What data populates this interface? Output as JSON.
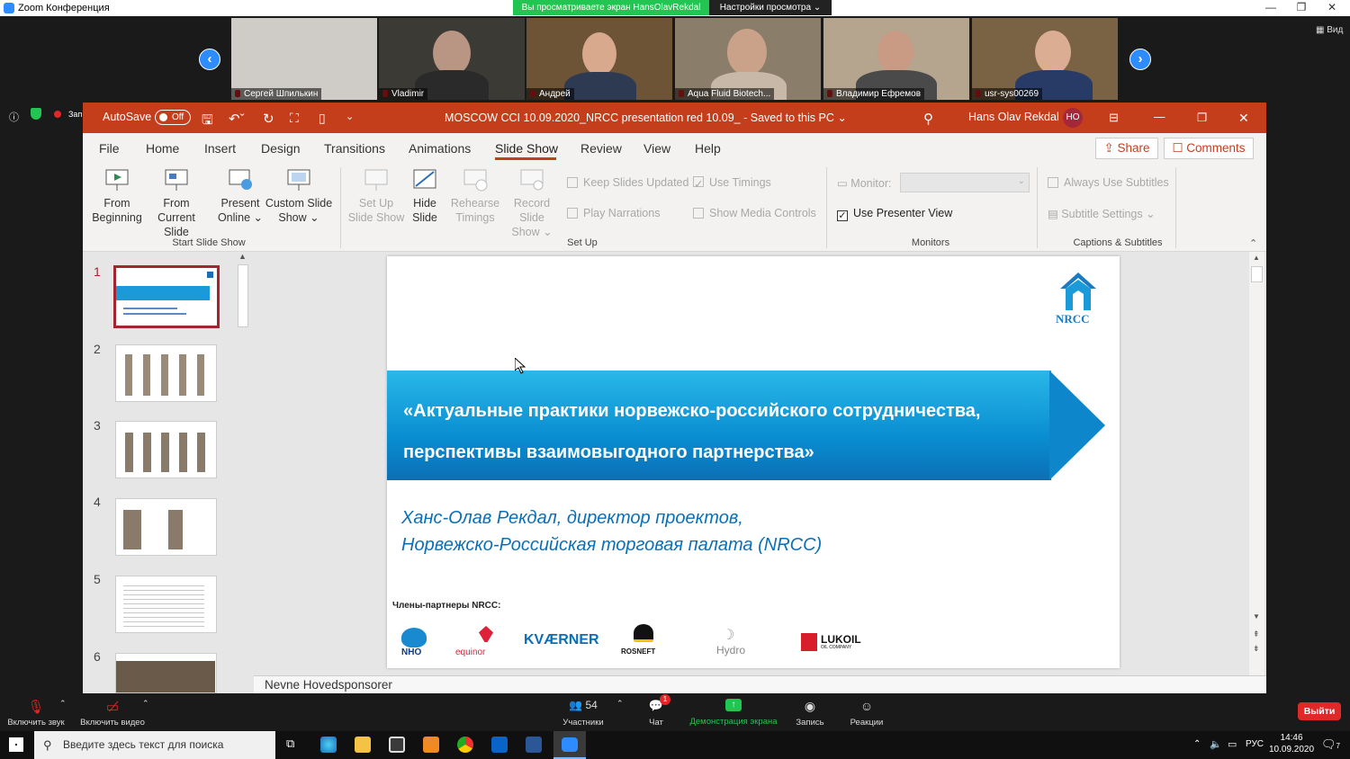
{
  "zoom": {
    "window_title": "Zoom Конференция",
    "share_banner": "Вы просматриваете экран HansOlavRekdal",
    "view_options": "Настройки просмотра ⌄",
    "view_label": "Вид",
    "participants_tiles": [
      "Сергей Шпилькин",
      "Vladimir",
      "Андрей",
      "Aqua Fluid Biotech...",
      "Владимир Ефремов",
      "usr-sys00269"
    ],
    "left_record": "Запись",
    "bottom": {
      "mute": "Включить звук",
      "video": "Включить видео",
      "participants": "Участники",
      "participants_count": "54",
      "chat": "Чат",
      "chat_badge": "1",
      "share": "Демонстрация экрана",
      "record": "Запись",
      "reactions": "Реакции",
      "leave": "Выйти"
    }
  },
  "ppt": {
    "autosave": "AutoSave",
    "autosave_state": "Off",
    "doc_title": "MOSCOW CCI 10.09.2020_NRCC presentation red 10.09_  -  Saved to this PC ⌄",
    "user_name": "Hans Olav Rekdal",
    "user_initials": "HO",
    "tabs": [
      "File",
      "Home",
      "Insert",
      "Design",
      "Transitions",
      "Animations",
      "Slide Show",
      "Review",
      "View",
      "Help"
    ],
    "share": "Share",
    "comments": "Comments",
    "ribbon": {
      "from_beginning": [
        "From",
        "Beginning"
      ],
      "from_current": [
        "From",
        "Current Slide"
      ],
      "present_online": [
        "Present",
        "Online ⌄"
      ],
      "custom_show": [
        "Custom Slide",
        "Show ⌄"
      ],
      "setup_show": [
        "Set Up",
        "Slide Show"
      ],
      "hide_slide": [
        "Hide",
        "Slide"
      ],
      "rehearse": [
        "Rehearse",
        "Timings"
      ],
      "record": [
        "Record Slide",
        "Show ⌄"
      ],
      "keep_updated": "Keep Slides Updated",
      "use_timings": "Use Timings",
      "play_narrations": "Play Narrations",
      "show_media": "Show Media Controls",
      "monitor": "Monitor:",
      "presenter_view": "Use Presenter View",
      "always_subtitles": "Always Use Subtitles",
      "subtitle_settings": "Subtitle Settings ⌄",
      "groups": [
        "Start Slide Show",
        "Set Up",
        "Monitors",
        "Captions & Subtitles"
      ]
    },
    "slide_numbers": [
      "1",
      "2",
      "3",
      "4",
      "5",
      "6"
    ],
    "slide": {
      "logo_text": "NRCC",
      "title_line1": "«Актуальные практики норвежско-российского сотрудничества,",
      "title_line2": "перспективы взаимовыгодного партнерства»",
      "author_line1": "Ханс-Олав Рекдал, директор проектов,",
      "author_line2": "Норвежско-Российская торговая палата (NRCC)",
      "partners_label": "Члены-партнеры NRCC:",
      "partners": [
        "NHO",
        "equinor",
        "KVÆRNER",
        "ROSNEFT",
        "Hydro",
        "LUKOIL"
      ],
      "lukoil_sub": "OIL COMPANY"
    },
    "notes": "Nevne Hovedsponsorer"
  },
  "taskbar": {
    "search_placeholder": "Введите здесь текст для поиска",
    "lang": "РУС",
    "time": "14:46",
    "date": "10.09.2020",
    "notif_count": "7"
  }
}
